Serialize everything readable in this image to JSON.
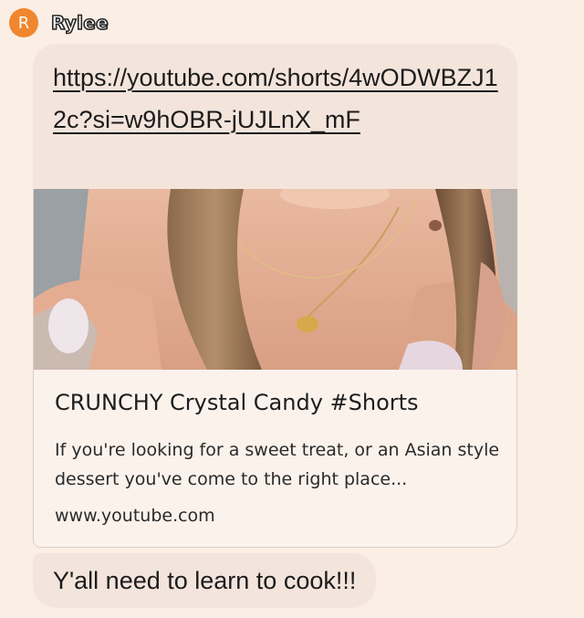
{
  "sender": {
    "avatar_letter": "R",
    "avatar_color": "#f0862f",
    "name": "Rylee"
  },
  "messages": [
    {
      "type": "link",
      "url_text": "https://youtube.com/shorts/4wODWBZJ12c?si=w9hOBR-jUJLnX_mF",
      "preview": {
        "thumbnail_icon": "video-thumbnail",
        "title": "CRUNCHY Crystal Candy #Shorts",
        "description": "If you're looking for a sweet treat, or an Asian style dessert you've come to the right place...",
        "domain": "www.youtube.com"
      }
    },
    {
      "type": "text",
      "text": "Y'all need to learn to cook!!!"
    }
  ],
  "colors": {
    "background": "#fbeee4",
    "bubble": "#f3e5dc",
    "card": "#fbf2ec"
  }
}
